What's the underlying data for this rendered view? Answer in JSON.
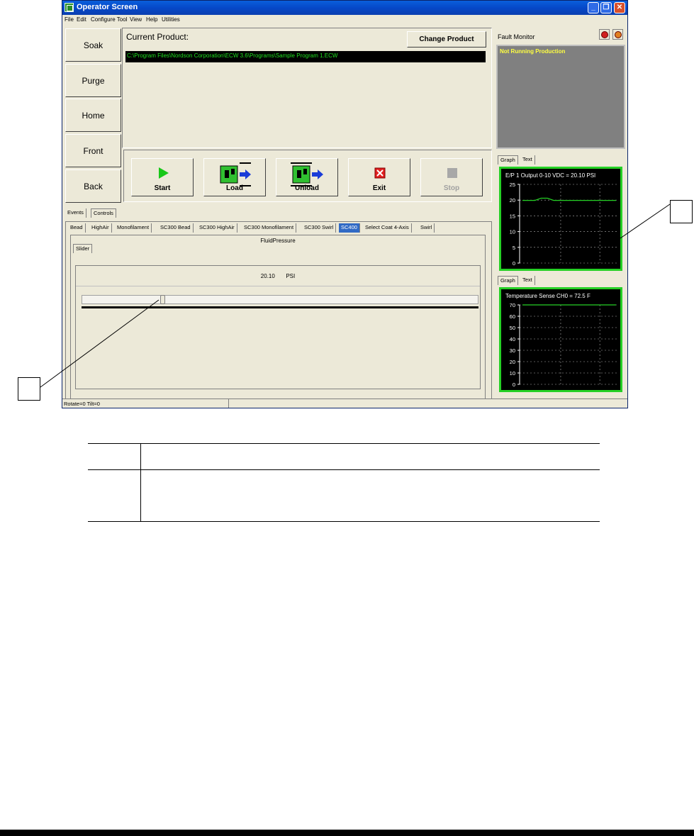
{
  "window": {
    "title": "Operator Screen"
  },
  "menu": [
    "File",
    "Edit",
    "Configure Tool",
    "View",
    "Help",
    "Utilities"
  ],
  "side_buttons": [
    "Soak",
    "Purge",
    "Home",
    "Front",
    "Back"
  ],
  "product": {
    "label": "Current Product:",
    "change_button": "Change Product",
    "path": "C:\\Program Files\\Nordson Corporation\\ECW 3.6\\Programs\\Sample Program 1.ECW"
  },
  "commands": [
    {
      "label": "Start",
      "enabled": true
    },
    {
      "label": "Load",
      "enabled": true
    },
    {
      "label": "Unload",
      "enabled": true
    },
    {
      "label": "Exit",
      "enabled": true
    },
    {
      "label": "Stop",
      "enabled": false
    }
  ],
  "event_tabs": [
    "Events",
    "Controls"
  ],
  "active_event_tab": "Controls",
  "control_tabs": [
    "Bead",
    "HighAir",
    "Monofilament",
    "SC300 Bead",
    "SC300 HighAir",
    "SC300 Monofilament",
    "SC300 Swirl",
    "SC400",
    "Select Coat 4-Axis",
    "Swirl"
  ],
  "selected_control_tab": "SC400",
  "control": {
    "title": "FluidPressure",
    "subtab": "Slider",
    "value": "20.10",
    "unit": "PSI",
    "slider_fraction": 0.2
  },
  "status": {
    "text": "Rotate=0 Tilt=0"
  },
  "fault_monitor": {
    "title": "Fault Monitor",
    "message": "Not Running Production"
  },
  "graph_tabs": [
    "Graph",
    "Text"
  ],
  "chart_data": [
    {
      "type": "line",
      "title": "E/P 1 Output 0-10 VDC = 20.10 PSI",
      "ylim": [
        0,
        25
      ],
      "yticks": [
        "25",
        "20",
        "15",
        "10",
        "5",
        "0"
      ],
      "grid": true,
      "series": [
        {
          "values": [
            19.9,
            19.9,
            19.9,
            20.6,
            20.6,
            19.9,
            19.9,
            19.9,
            19.9,
            19.9,
            19.9,
            19.9,
            19.9,
            19.9,
            19.9,
            19.9
          ]
        }
      ]
    },
    {
      "type": "line",
      "title": "Temperature Sense CH0 = 72.5 F",
      "ylim": [
        0,
        70
      ],
      "yticks": [
        "70",
        "60",
        "50",
        "40",
        "30",
        "20",
        "10",
        "0"
      ],
      "grid": true,
      "series": [
        {
          "values": [
            72,
            72,
            72,
            72,
            72,
            72,
            72,
            72,
            72,
            72,
            72,
            72,
            72,
            72,
            72,
            72
          ]
        }
      ]
    }
  ]
}
